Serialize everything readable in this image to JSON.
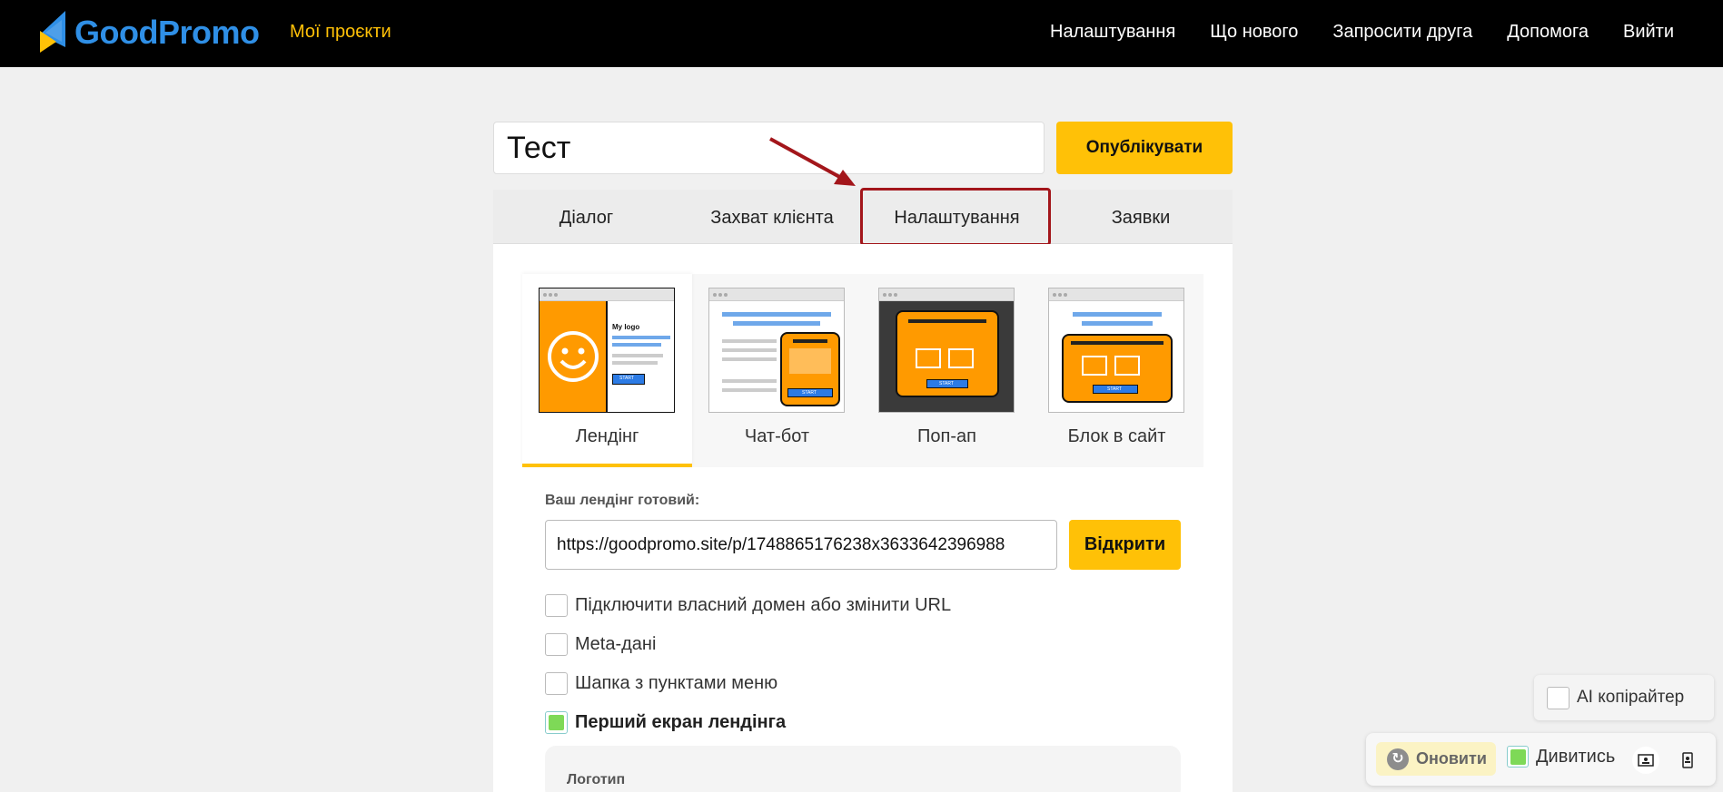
{
  "header": {
    "logo_text": "GoodPromo",
    "my_projects": "Мої проєкти",
    "nav": [
      "Налаштування",
      "Що нового",
      "Запросити друга",
      "Допомога",
      "Вийти"
    ]
  },
  "project": {
    "title": "Тест",
    "publish_label": "Опублікувати"
  },
  "tabs": [
    "Діалог",
    "Захват клієнта",
    "Налаштування",
    "Заявки"
  ],
  "modes": [
    {
      "label": "Лендінг",
      "active": true
    },
    {
      "label": "Чат-бот",
      "active": false
    },
    {
      "label": "Поп-ап",
      "active": false
    },
    {
      "label": "Блок в сайт",
      "active": false
    }
  ],
  "thumb_text": {
    "my_logo": "My logo",
    "start": "START"
  },
  "landing": {
    "ready_label": "Ваш лендінг готовий:",
    "url": "https://goodpromo.site/p/1748865176238x3633642396988",
    "open_label": "Відкрити"
  },
  "options": [
    {
      "label": "Підключити власний домен або змінити URL",
      "checked": false
    },
    {
      "label": "Meta-дані",
      "checked": false
    },
    {
      "label": "Шапка з пунктами меню",
      "checked": false
    },
    {
      "label": "Перший екран лендінга",
      "checked": true
    }
  ],
  "logo_section_label": "Логотип",
  "widgets": {
    "ai_copywriter": "AI копірайтер",
    "refresh_label": "Оновити",
    "watch_label": "Дивитись"
  },
  "colors": {
    "accent": "#ffc107",
    "brand_blue": "#2f8fe6",
    "highlight": "#a3161b",
    "check_green": "#7ed957"
  }
}
